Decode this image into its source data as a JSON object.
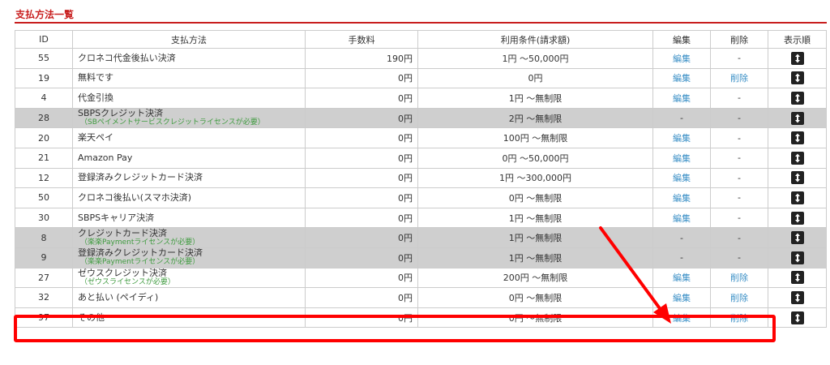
{
  "page": {
    "title": "支払方法一覧"
  },
  "table": {
    "headers": [
      "ID",
      "支払方法",
      "手数料",
      "利用条件(請求額)",
      "編集",
      "削除",
      "表示順"
    ],
    "rows": [
      {
        "id": "55",
        "name": "クロネコ代金後払い決済",
        "note": "",
        "fee": "190円",
        "cond": "1円 ～50,000円",
        "edit": "編集",
        "del": "-",
        "disabled": false
      },
      {
        "id": "19",
        "name": "無料です",
        "note": "",
        "fee": "0円",
        "cond": "0円",
        "edit": "編集",
        "del": "削除",
        "disabled": false
      },
      {
        "id": "4",
        "name": "代金引換",
        "note": "",
        "fee": "0円",
        "cond": "1円 ～無制限",
        "edit": "編集",
        "del": "-",
        "disabled": false
      },
      {
        "id": "28",
        "name": "SBPSクレジット決済",
        "note": "（SBペイメントサービスクレジットライセンスが必要）",
        "fee": "0円",
        "cond": "2円 ～無制限",
        "edit": "-",
        "del": "-",
        "disabled": true
      },
      {
        "id": "20",
        "name": "楽天ペイ",
        "note": "",
        "fee": "0円",
        "cond": "100円 ～無制限",
        "edit": "編集",
        "del": "-",
        "disabled": false
      },
      {
        "id": "21",
        "name": "Amazon Pay",
        "note": "",
        "fee": "0円",
        "cond": "0円 ～50,000円",
        "edit": "編集",
        "del": "-",
        "disabled": false
      },
      {
        "id": "12",
        "name": "登録済みクレジットカード決済",
        "note": "",
        "fee": "0円",
        "cond": "1円 ～300,000円",
        "edit": "編集",
        "del": "-",
        "disabled": false
      },
      {
        "id": "50",
        "name": "クロネコ後払い(スマホ決済)",
        "note": "",
        "fee": "0円",
        "cond": "0円 ～無制限",
        "edit": "編集",
        "del": "-",
        "disabled": false
      },
      {
        "id": "30",
        "name": "SBPSキャリア決済",
        "note": "",
        "fee": "0円",
        "cond": "1円 ～無制限",
        "edit": "編集",
        "del": "-",
        "disabled": false
      },
      {
        "id": "8",
        "name": "クレジットカード決済",
        "note": "（楽楽Paymentライセンスが必要）",
        "fee": "0円",
        "cond": "1円 ～無制限",
        "edit": "-",
        "del": "-",
        "disabled": true
      },
      {
        "id": "9",
        "name": "登録済みクレジットカード決済",
        "note": "（楽楽Paymentライセンスが必要）",
        "fee": "0円",
        "cond": "1円 ～無制限",
        "edit": "-",
        "del": "-",
        "disabled": true
      },
      {
        "id": "27",
        "name": "ゼウスクレジット決済",
        "note": "（ゼウスライセンスが必要）",
        "fee": "0円",
        "cond": "200円 ～無制限",
        "edit": "編集",
        "del": "削除",
        "disabled": false
      },
      {
        "id": "32",
        "name": "あと払い (ペイディ)",
        "note": "",
        "fee": "0円",
        "cond": "0円 ～無制限",
        "edit": "編集",
        "del": "削除",
        "disabled": false
      },
      {
        "id": "97",
        "name": "その他",
        "note": "",
        "fee": "0円",
        "cond": "0円 ～無制限",
        "edit": "編集",
        "del": "削除",
        "disabled": false
      }
    ]
  },
  "icons": {
    "sort": "sort-updown-icon"
  },
  "colors": {
    "accent": "#c81e1e",
    "link": "#3a8fc6",
    "note": "#3f9b3f",
    "disabled_row": "#cfcfcf",
    "annotation": "#ff0000"
  }
}
